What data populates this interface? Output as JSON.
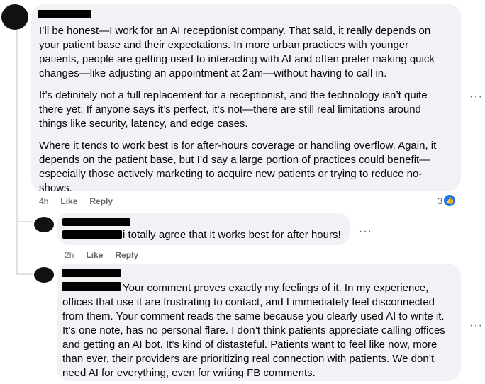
{
  "comment1": {
    "paragraphs": [
      "I’ll be honest—I work for an AI receptionist company. That said, it really depends on your patient base and their expectations. In more urban practices with younger patients, people are getting used to interacting with AI and often prefer making quick changes—like adjusting an appointment at 2am—without having to call in.",
      "It’s definitely not a full replacement for a receptionist, and the technology isn’t quite there yet. If anyone says it’s perfect, it’s not—there are still real limitations around things like security, latency, and edge cases.",
      "Where it tends to work best is for after-hours coverage or handling overflow. Again, it depends on the patient base, but I’d say a large portion of practices could benefit—especially those actively marketing to acquire new patients or trying to reduce no-shows."
    ],
    "time": "4h",
    "like_label": "Like",
    "reply_label": "Reply",
    "like_count": "3",
    "more_label": "···"
  },
  "reply1": {
    "text": "i totally agree that it works best for after hours!",
    "time": "2h",
    "like_label": "Like",
    "reply_label": "Reply",
    "more_label": "···"
  },
  "reply2": {
    "text": "Your comment proves exactly my feelings of it. In my experience, offices that use it are frustrating to contact, and I immediately feel disconnected from them. Your comment reads the same because you clearly used AI to write it. It’s one note, has no personal flare. I don’t think patients appreciate calling offices and getting an AI bot. It’s kind of distasteful. Patients want to feel like now, more than ever, their providers are prioritizing real connection with patients. We don’t need AI for everything, even for writing FB comments.",
    "more_label": "···"
  }
}
